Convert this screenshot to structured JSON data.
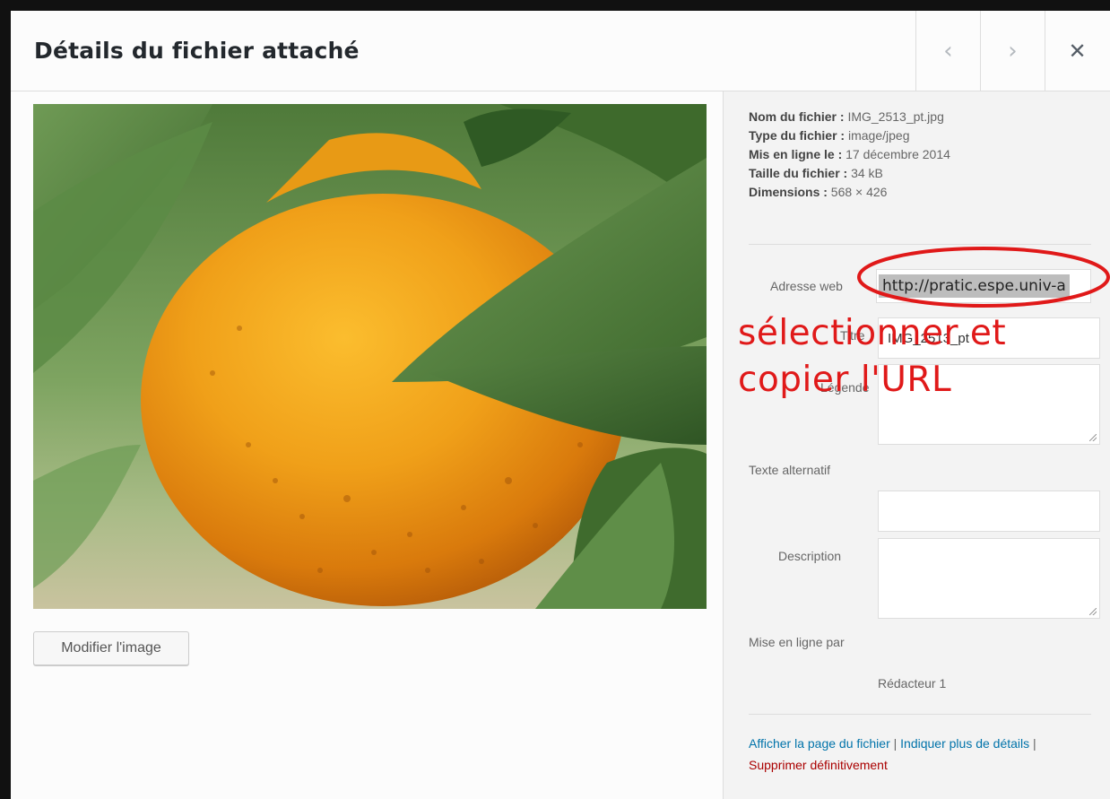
{
  "modal": {
    "title": "Détails du fichier attaché",
    "prev_icon": "chevron-left-icon",
    "next_icon": "chevron-right-icon",
    "close_icon": "close-icon",
    "prev_glyph": "‹",
    "next_glyph": "›",
    "close_glyph": "✕"
  },
  "preview": {
    "edit_button": "Modifier l'image"
  },
  "details": {
    "filename_label": "Nom du fichier :",
    "filename": "IMG_2513_pt.jpg",
    "filetype_label": "Type du fichier :",
    "filetype": "image/jpeg",
    "uploaded_label": "Mis en ligne le :",
    "uploaded": "17 décembre 2014",
    "filesize_label": "Taille du fichier :",
    "filesize": "34 kB",
    "dimensions_label": "Dimensions :",
    "dimensions": "568 × 426"
  },
  "form": {
    "url_label": "Adresse web",
    "url_value": "http://pratic.espe.univ-a",
    "title_label": "Titre",
    "title_value": "IMG_2513_pt",
    "caption_label": "Légende",
    "caption_value": "",
    "alt_label": "Texte alternatif",
    "alt_value": "",
    "description_label": "Description",
    "description_value": "",
    "uploaded_by_label": "Mise en ligne par",
    "uploaded_by": "Rédacteur 1"
  },
  "links": {
    "view_page": "Afficher la page du fichier",
    "more_details": "Indiquer plus de détails",
    "delete": "Supprimer définitivement",
    "separator": " | "
  },
  "annotation": {
    "line1": "sélectionner et",
    "line2": "copier l'URL",
    "color": "#e01919"
  },
  "colors": {
    "link": "#0073aa",
    "danger": "#a00",
    "orange": "#e8950c"
  }
}
